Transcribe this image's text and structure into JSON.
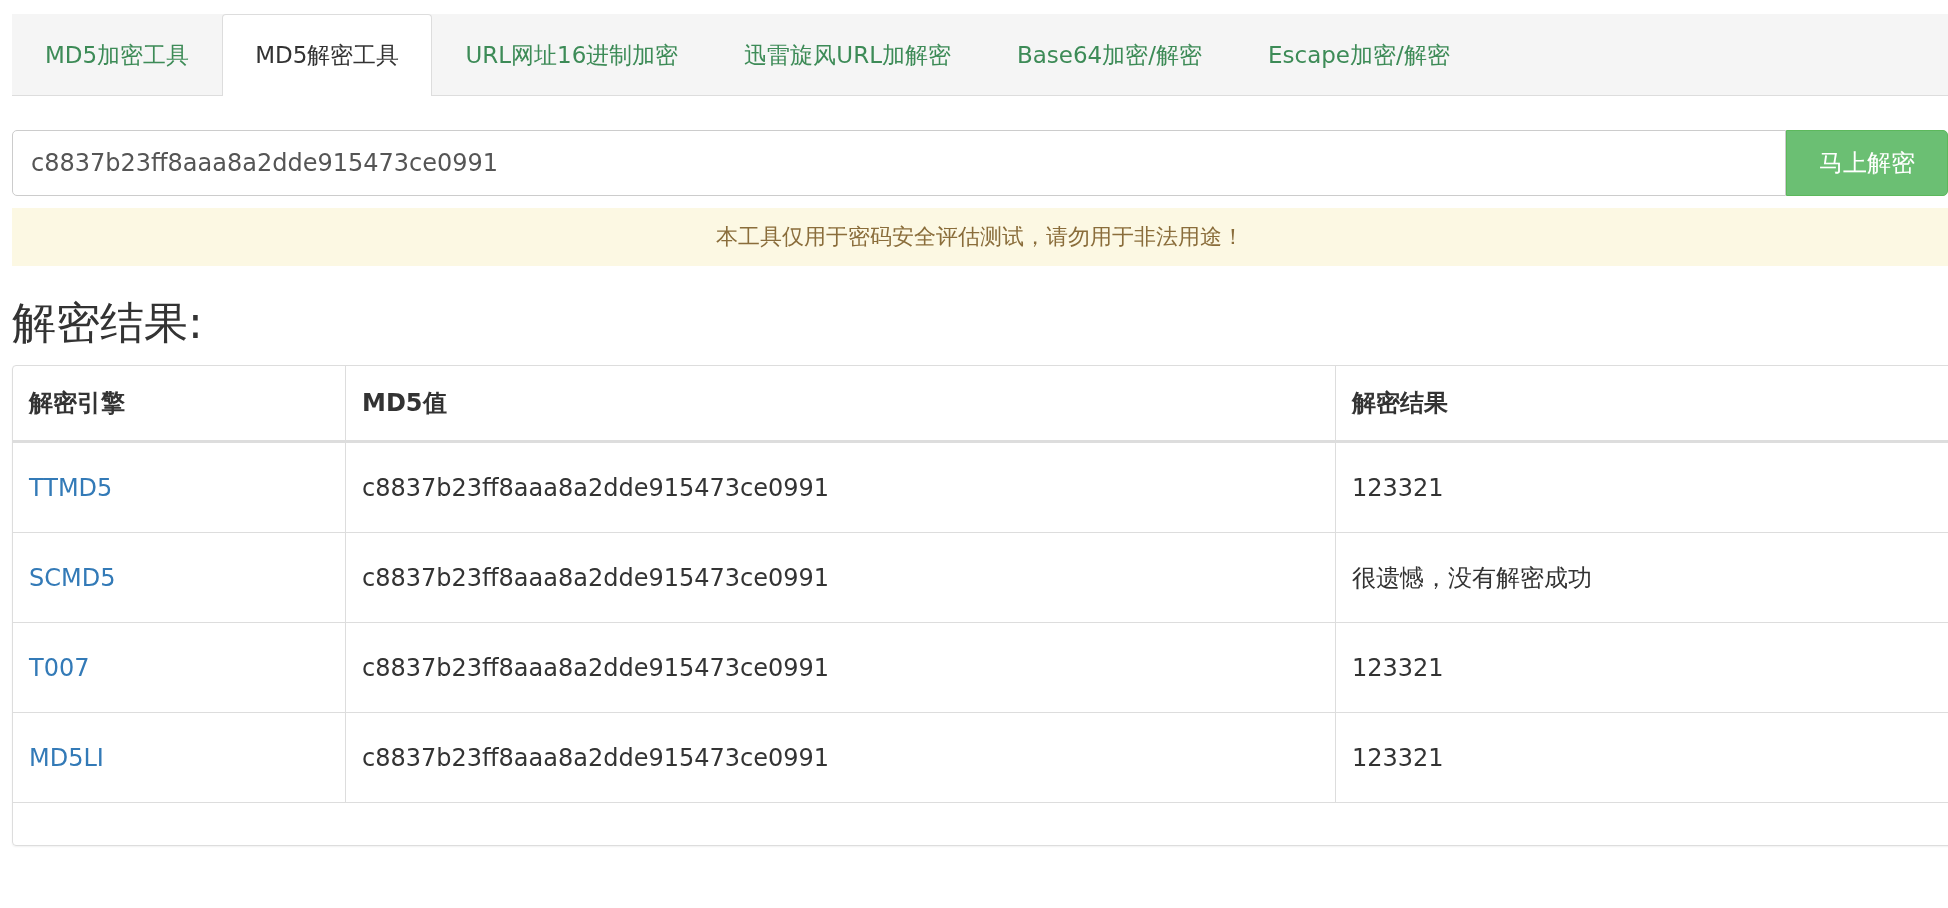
{
  "tabs": [
    {
      "label": "MD5加密工具",
      "selected": false
    },
    {
      "label": "MD5解密工具",
      "selected": true
    },
    {
      "label": "URL网址16进制加密",
      "selected": false
    },
    {
      "label": "迅雷旋风URL加解密",
      "selected": false
    },
    {
      "label": "Base64加密/解密",
      "selected": false
    },
    {
      "label": "Escape加密/解密",
      "selected": false
    }
  ],
  "hash_input": {
    "value": "c8837b23ff8aaa8a2dde915473ce0991"
  },
  "decrypt_button": "马上解密",
  "notice": "本工具仅用于密码安全评估测试，请勿用于非法用途！",
  "results_heading": "解密结果:",
  "table": {
    "columns": [
      "解密引擎",
      "MD5值",
      "解密结果"
    ],
    "rows": [
      {
        "engine": "TTMD5",
        "md5": "c8837b23ff8aaa8a2dde915473ce0991",
        "result": "123321"
      },
      {
        "engine": "SCMD5",
        "md5": "c8837b23ff8aaa8a2dde915473ce0991",
        "result": "很遗憾，没有解密成功"
      },
      {
        "engine": "T007",
        "md5": "c8837b23ff8aaa8a2dde915473ce0991",
        "result": "123321"
      },
      {
        "engine": "MD5LI",
        "md5": "c8837b23ff8aaa8a2dde915473ce0991",
        "result": "123321"
      }
    ]
  }
}
